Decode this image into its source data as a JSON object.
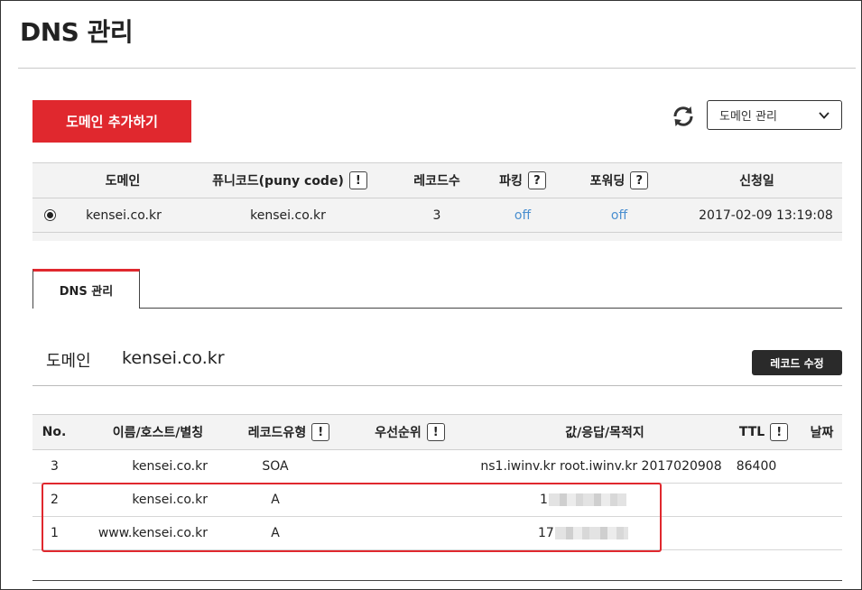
{
  "page": {
    "title": "DNS 관리"
  },
  "toolbar": {
    "add_domain_label": "도메인 추가하기",
    "select_value": "도메인 관리"
  },
  "domain_table": {
    "headers": {
      "domain": "도메인",
      "punycode": "퓨니코드(puny code)",
      "record_count": "레코드수",
      "parking": "파킹",
      "forwarding": "포워딩",
      "date": "신청일"
    },
    "help_glyph_excl": "!",
    "help_glyph_q": "?",
    "rows": [
      {
        "domain": "kensei.co.kr",
        "punycode": "kensei.co.kr",
        "record_count": "3",
        "parking": "off",
        "forwarding": "off",
        "date": "2017-02-09 13:19:08"
      }
    ]
  },
  "tabs": [
    {
      "label": "DNS 관리"
    }
  ],
  "dns_section": {
    "domain_label": "도메인",
    "domain_value": "kensei.co.kr",
    "edit_label": "레코드 수정"
  },
  "records_table": {
    "headers": {
      "no": "No.",
      "name": "이름/호스트/별칭",
      "type": "레코드유형",
      "priority": "우선순위",
      "value": "값/응답/목적지",
      "ttl": "TTL",
      "date": "날짜"
    },
    "rows": [
      {
        "no": "3",
        "name": "kensei.co.kr",
        "type": "SOA",
        "value": "ns1.iwinv.kr root.iwinv.kr 2017020908",
        "ttl": "86400"
      },
      {
        "no": "2",
        "name": "kensei.co.kr",
        "type": "A",
        "value": "1"
      },
      {
        "no": "1",
        "name": "www.kensei.co.kr",
        "type": "A",
        "value": "17"
      }
    ]
  },
  "colors": {
    "accent": "#e0282e",
    "link": "#4a8fd0",
    "dark_button": "#2a2a2a"
  }
}
